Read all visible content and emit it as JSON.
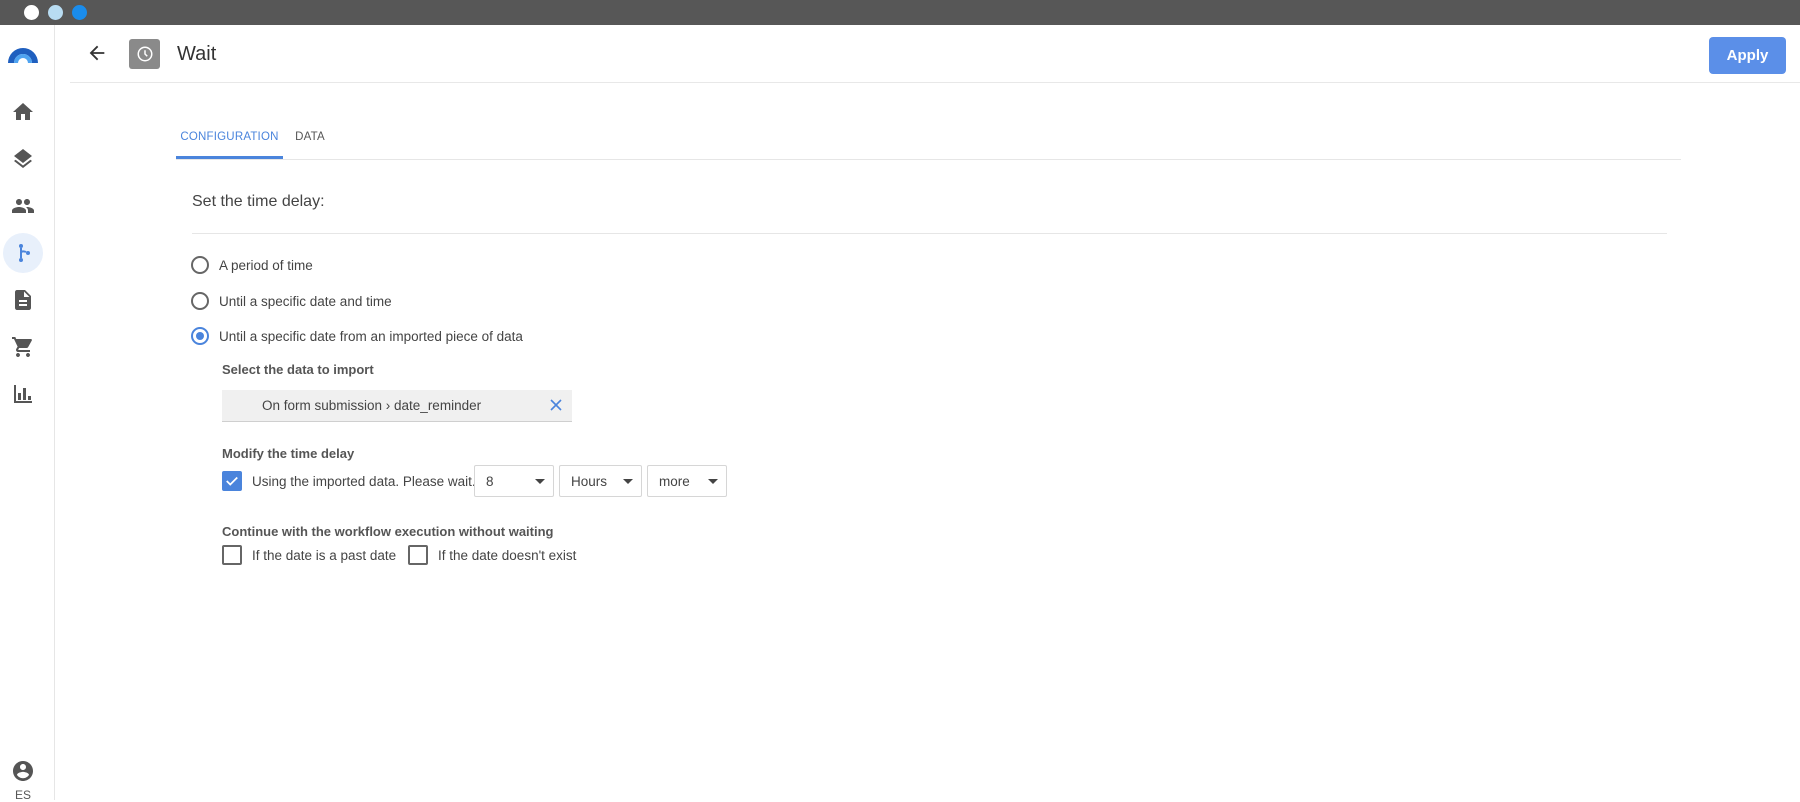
{
  "app": {
    "accent_color": "#4a84dc",
    "button_color": "#5b8fe8"
  },
  "sidebar": {
    "items": [
      {
        "name": "home",
        "icon": "home-icon"
      },
      {
        "name": "layers",
        "icon": "layers-icon"
      },
      {
        "name": "contacts",
        "icon": "people-icon"
      },
      {
        "name": "workflows",
        "icon": "workflow-icon",
        "active": true
      },
      {
        "name": "documents",
        "icon": "document-icon"
      },
      {
        "name": "shop",
        "icon": "cart-icon"
      },
      {
        "name": "reports",
        "icon": "bar-chart-icon"
      }
    ],
    "user_label": "ES"
  },
  "header": {
    "title": "Wait",
    "apply_label": "Apply"
  },
  "tabs": [
    {
      "label": "CONFIGURATION",
      "active": true
    },
    {
      "label": "DATA",
      "active": false
    }
  ],
  "config": {
    "section_title": "Set the time delay:",
    "radios": [
      {
        "label": "A period of time",
        "checked": false
      },
      {
        "label": "Until a specific date and time",
        "checked": false
      },
      {
        "label": "Until a specific date from an imported piece of data",
        "checked": true
      }
    ],
    "import": {
      "label": "Select the data to import",
      "value": "On form submission › date_reminder"
    },
    "modify": {
      "label": "Modify the time delay",
      "checkbox_label": "Using the imported data. Please wait.",
      "checked": true,
      "amount": "8",
      "unit": "Hours",
      "direction": "more"
    },
    "continue": {
      "label": "Continue with the workflow execution without waiting",
      "past_date_label": "If the date is a past date",
      "past_date_checked": false,
      "missing_date_label": "If the date doesn't exist",
      "missing_date_checked": false
    }
  }
}
